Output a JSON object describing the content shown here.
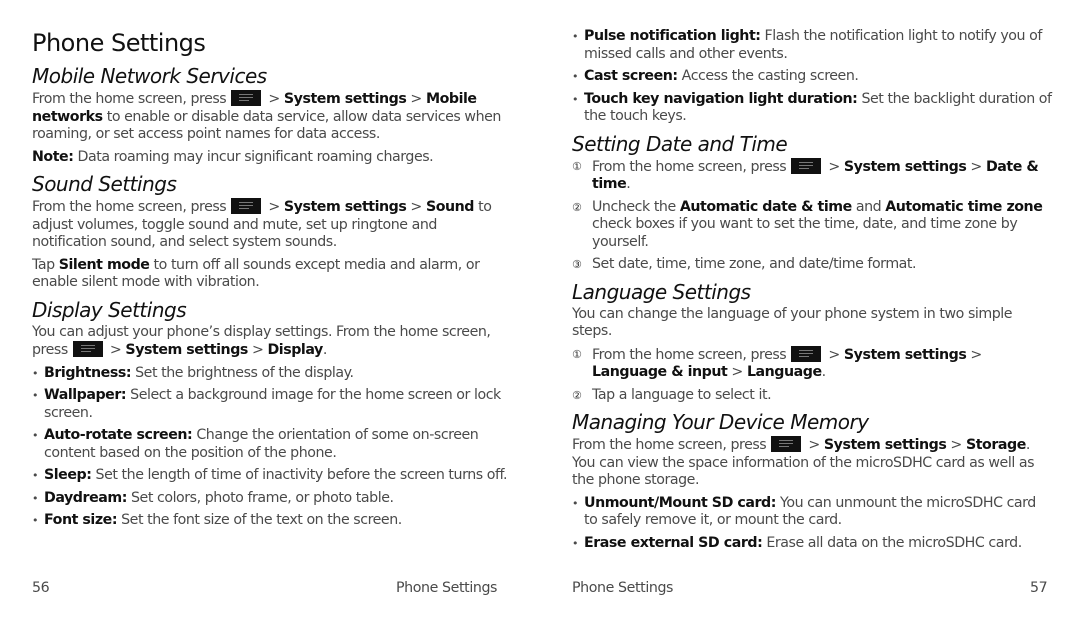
{
  "left_page": {
    "title": "Phone Settings",
    "mobile": {
      "heading": "Mobile Network Services",
      "p1_pre": "From the home screen, press",
      "p1_sep1": " > ",
      "p1_b1": "System settings",
      "p1_sep2": " > ",
      "p1_b2": "Mobile networks",
      "p1_post": " to enable or disable data service, allow data services when roaming, or set access point names for data access.",
      "note_label": "Note:",
      "note_text": " Data roaming may incur significant roaming charges."
    },
    "sound": {
      "heading": "Sound Settings",
      "p1_pre": "From the home screen, press",
      "p1_sep1": " > ",
      "p1_b1": "System settings",
      "p1_sep2": " > ",
      "p1_b2": "Sound",
      "p1_post": " to adjust volumes, toggle sound and mute, set up ringtone and notification sound, and select system sounds.",
      "p2_pre": "Tap ",
      "p2_b": "Silent mode",
      "p2_post": " to turn off all sounds except media and alarm, or enable silent mode with vibration."
    },
    "display": {
      "heading": "Display Settings",
      "p1_pre": "You can adjust your phone’s display settings. From the home screen, press",
      "p1_sep1": " > ",
      "p1_b1": "System settings",
      "p1_sep2": " > ",
      "p1_b2": "Display",
      "p1_post": ".",
      "items": [
        {
          "label": "Brightness:",
          "text": " Set the brightness of the display."
        },
        {
          "label": "Wallpaper:",
          "text": " Select a background image for the home screen or lock screen."
        },
        {
          "label": "Auto-rotate screen:",
          "text": " Change the orientation of some on-screen content based on the position of the phone."
        },
        {
          "label": "Sleep:",
          "text": " Set the length of time of inactivity before the screen turns off."
        },
        {
          "label": "Daydream:",
          "text": " Set colors, photo frame, or photo table."
        },
        {
          "label": "Font size:",
          "text": " Set the font size of the text on the screen."
        }
      ]
    },
    "footer": {
      "page_number": "56",
      "section": "Phone Settings"
    }
  },
  "right_page": {
    "display_items": [
      {
        "label": "Pulse notification light:",
        "text": " Flash the notification light to notify you of missed calls and other events."
      },
      {
        "label": "Cast screen:",
        "text": " Access the casting screen."
      },
      {
        "label": "Touch key navigation light duration:",
        "text": " Set the backlight duration of the touch keys."
      }
    ],
    "datetime": {
      "heading": "Setting Date and Time",
      "step1": {
        "num": "①",
        "pre": "From the home screen, press",
        "sep1": " > ",
        "b1": "System settings",
        "sep2": " > ",
        "b2": "Date & time",
        "post": "."
      },
      "step2": {
        "num": "②",
        "pre": "Uncheck the ",
        "b1": "Automatic date & time",
        "mid": " and ",
        "b2": "Automatic time zone",
        "post": " check boxes if you want to set the time, date, and time zone by yourself."
      },
      "step3": {
        "num": "③",
        "text": "Set date, time, time zone, and date/time format."
      }
    },
    "language": {
      "heading": "Language Settings",
      "intro": "You can change the language of your phone system in two simple steps.",
      "step1": {
        "num": "①",
        "pre": "From the home screen, press",
        "sep1": " > ",
        "b1": "System settings",
        "sep2": " > ",
        "b2": "Language & input",
        "sep3": " > ",
        "b3": "Language",
        "post": "."
      },
      "step2": {
        "num": "②",
        "text": "Tap a language to select it."
      }
    },
    "memory": {
      "heading": "Managing Your Device Memory",
      "p1_pre": "From the home screen, press",
      "p1_sep1": " > ",
      "p1_b1": "System settings",
      "p1_sep2": " > ",
      "p1_b2": "Storage",
      "p1_post": ". You can view the space information of the microSDHC card as well as the phone storage.",
      "items": [
        {
          "label": "Unmount/Mount SD card:",
          "text": " You can unmount the microSDHC card to safely remove it, or mount the card."
        },
        {
          "label": "Erase external SD card:",
          "text": " Erase all data on the microSDHC card."
        }
      ]
    },
    "footer": {
      "section": "Phone Settings",
      "page_number": "57"
    }
  },
  "icons": {
    "menu_key": "menu-key-icon"
  }
}
